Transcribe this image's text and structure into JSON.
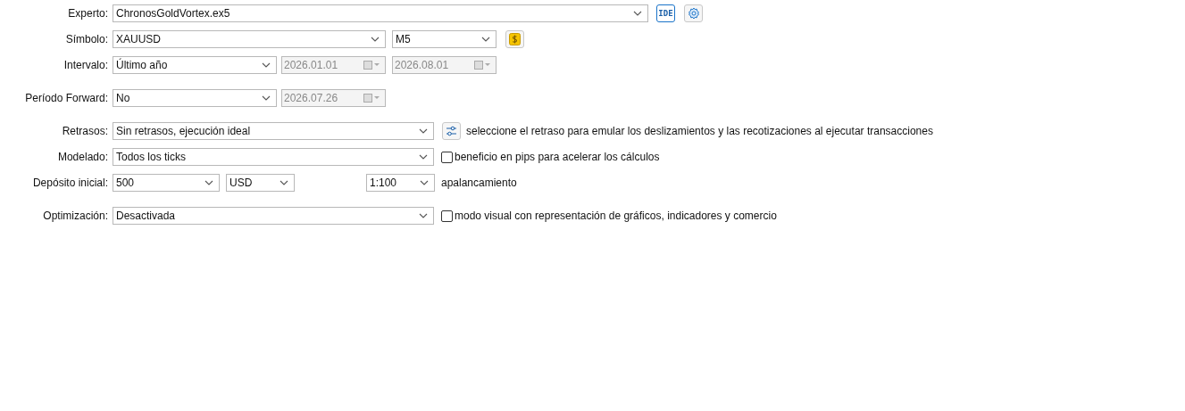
{
  "experto": {
    "label": "Experto:",
    "value": "ChronosGoldVortex.ex5",
    "ide_button": "IDE"
  },
  "simbolo": {
    "label": "Símbolo:",
    "value": "XAUUSD",
    "timeframe": "M5"
  },
  "intervalo": {
    "label": "Intervalo:",
    "value": "Último año",
    "dates": [
      {
        "value": "2026.01.01",
        "disabled": true
      },
      {
        "value": "2026.08.01",
        "disabled": true
      }
    ]
  },
  "periodo_forward": {
    "label": "Período Forward:",
    "value": "No",
    "dates": [
      {
        "value": "2026.07.26",
        "disabled": true
      }
    ]
  },
  "retrasos": {
    "label": "Retrasos:",
    "value": "Sin retrasos, ejecución ideal",
    "hint": "seleccione el retraso para emular los deslizamientos y las recotizaciones al ejecutar transacciones"
  },
  "modelado": {
    "label": "Modelado:",
    "value": "Todos los ticks",
    "checkbox": {
      "label": "beneficio en pips para acelerar los cálculos",
      "checked": false
    }
  },
  "deposito": {
    "label": "Depósito inicial:",
    "value": "500",
    "currency": "USD",
    "leverage": "1:100",
    "leverage_label": "apalancamiento"
  },
  "optimizacion": {
    "label": "Optimización:",
    "value": "Desactivada",
    "checkbox": {
      "label": "modo visual con representación de gráficos, indicadores y comercio",
      "checked": false
    }
  }
}
